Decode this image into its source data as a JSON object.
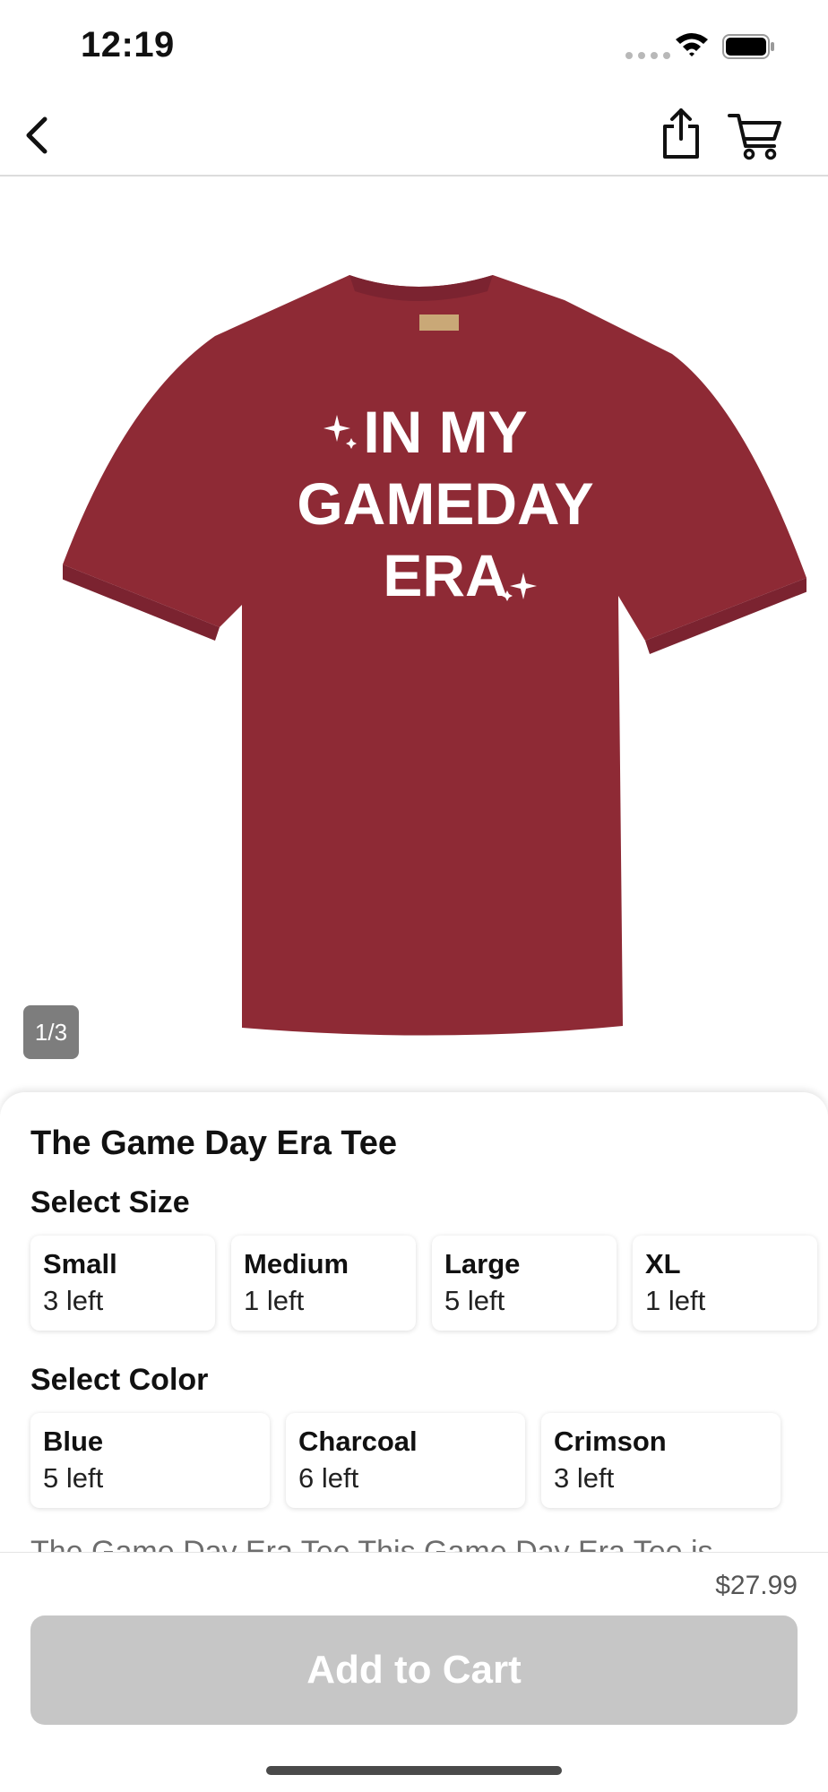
{
  "status_bar": {
    "time": "12:19"
  },
  "nav": {
    "icons": [
      "back-icon",
      "share-icon",
      "cart-icon"
    ]
  },
  "hero": {
    "image_counter": "1/3",
    "shirt_color": "#8e2a35",
    "print_lines": [
      "IN MY",
      "GAMEDAY",
      "ERA"
    ]
  },
  "product": {
    "title": "The Game Day Era Tee",
    "size_label": "Select Size",
    "sizes": [
      {
        "name": "Small",
        "stock": "3 left"
      },
      {
        "name": "Medium",
        "stock": "1 left"
      },
      {
        "name": "Large",
        "stock": "5 left"
      },
      {
        "name": "XL",
        "stock": "1 left"
      }
    ],
    "color_label": "Select Color",
    "colors": [
      {
        "name": "Blue",
        "stock": "5 left"
      },
      {
        "name": "Charcoal",
        "stock": "6 left"
      },
      {
        "name": "Crimson",
        "stock": "3 left"
      }
    ],
    "description_peek": "The Game Day Era Tee This Game Day Era Tee is"
  },
  "footer": {
    "price": "$27.99",
    "add_to_cart": "Add to Cart",
    "button_color": "#c6c6c6"
  }
}
